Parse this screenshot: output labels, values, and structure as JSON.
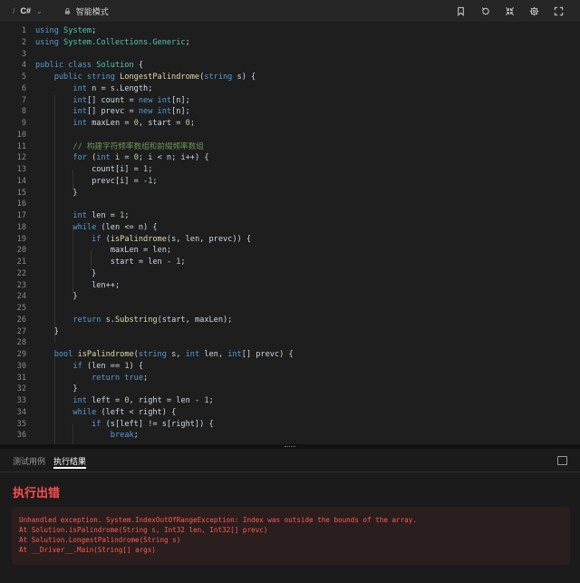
{
  "toolbar": {
    "slash": "/",
    "language": "C#",
    "chevron": "⌄",
    "mode_label": "智能模式",
    "icons": [
      "bookmark-icon",
      "undo-icon",
      "shrink-icon",
      "gear-icon",
      "fullscreen-icon"
    ]
  },
  "editor": {
    "lines": [
      {
        "n": "1",
        "t": [
          [
            "kw",
            "using "
          ],
          [
            "ty",
            "System"
          ],
          [
            "p",
            ";"
          ]
        ]
      },
      {
        "n": "2",
        "t": [
          [
            "kw",
            "using "
          ],
          [
            "ty",
            "System.Collections.Generic"
          ],
          [
            "p",
            ";"
          ]
        ]
      },
      {
        "n": "3",
        "t": []
      },
      {
        "n": "4",
        "t": [
          [
            "kw",
            "public class "
          ],
          [
            "ty",
            "Solution"
          ],
          [
            "p",
            " {"
          ]
        ]
      },
      {
        "n": "5",
        "t": [
          [
            "p",
            "    "
          ],
          [
            "kw",
            "public string "
          ],
          [
            "fn",
            "LongestPalindrome"
          ],
          [
            "p",
            "("
          ],
          [
            "kw",
            "string"
          ],
          [
            "p",
            " s) {"
          ]
        ]
      },
      {
        "n": "6",
        "t": [
          [
            "p",
            "        "
          ],
          [
            "kw",
            "int"
          ],
          [
            "p",
            " n = s.Length;"
          ]
        ]
      },
      {
        "n": "7",
        "t": [
          [
            "p",
            "        "
          ],
          [
            "kw",
            "int"
          ],
          [
            "p",
            "[] count = "
          ],
          [
            "kw",
            "new int"
          ],
          [
            "p",
            "[n];"
          ]
        ]
      },
      {
        "n": "8",
        "t": [
          [
            "p",
            "        "
          ],
          [
            "kw",
            "int"
          ],
          [
            "p",
            "[] prevc = "
          ],
          [
            "kw",
            "new int"
          ],
          [
            "p",
            "[n];"
          ]
        ]
      },
      {
        "n": "9",
        "t": [
          [
            "p",
            "        "
          ],
          [
            "kw",
            "int"
          ],
          [
            "p",
            " maxLen = "
          ],
          [
            "num",
            "0"
          ],
          [
            "p",
            ", start = "
          ],
          [
            "num",
            "0"
          ],
          [
            "p",
            ";"
          ]
        ]
      },
      {
        "n": "10",
        "t": []
      },
      {
        "n": "11",
        "t": [
          [
            "p",
            "        "
          ],
          [
            "cm",
            "// 构建字符频率数组和前缀频率数组"
          ]
        ]
      },
      {
        "n": "12",
        "t": [
          [
            "p",
            "        "
          ],
          [
            "kw",
            "for"
          ],
          [
            "p",
            " ("
          ],
          [
            "kw",
            "int"
          ],
          [
            "p",
            " i = "
          ],
          [
            "num",
            "0"
          ],
          [
            "p",
            "; i < n; i++) {"
          ]
        ]
      },
      {
        "n": "13",
        "t": [
          [
            "p",
            "            count[i] = "
          ],
          [
            "num",
            "1"
          ],
          [
            "p",
            ";"
          ]
        ]
      },
      {
        "n": "14",
        "t": [
          [
            "p",
            "            prevc[i] = -"
          ],
          [
            "num",
            "1"
          ],
          [
            "p",
            ";"
          ]
        ]
      },
      {
        "n": "15",
        "t": [
          [
            "p",
            "        }"
          ]
        ]
      },
      {
        "n": "16",
        "t": []
      },
      {
        "n": "17",
        "t": [
          [
            "p",
            "        "
          ],
          [
            "kw",
            "int"
          ],
          [
            "p",
            " len = "
          ],
          [
            "num",
            "1"
          ],
          [
            "p",
            ";"
          ]
        ]
      },
      {
        "n": "18",
        "t": [
          [
            "p",
            "        "
          ],
          [
            "kw",
            "while"
          ],
          [
            "p",
            " (len <= n) {"
          ]
        ]
      },
      {
        "n": "19",
        "t": [
          [
            "p",
            "            "
          ],
          [
            "kw",
            "if"
          ],
          [
            "p",
            " ("
          ],
          [
            "fn",
            "isPalindrome"
          ],
          [
            "p",
            "(s, len, prevc)) {"
          ]
        ]
      },
      {
        "n": "20",
        "t": [
          [
            "p",
            "                maxLen = len;"
          ]
        ]
      },
      {
        "n": "21",
        "t": [
          [
            "p",
            "                start = len - "
          ],
          [
            "num",
            "1"
          ],
          [
            "p",
            ";"
          ]
        ]
      },
      {
        "n": "22",
        "t": [
          [
            "p",
            "            }"
          ]
        ]
      },
      {
        "n": "23",
        "t": [
          [
            "p",
            "            len++;"
          ]
        ]
      },
      {
        "n": "24",
        "t": [
          [
            "p",
            "        }"
          ]
        ]
      },
      {
        "n": "25",
        "t": []
      },
      {
        "n": "26",
        "t": [
          [
            "p",
            "        "
          ],
          [
            "kw",
            "return"
          ],
          [
            "p",
            " s."
          ],
          [
            "fn",
            "Substring"
          ],
          [
            "p",
            "(start, maxLen);"
          ]
        ]
      },
      {
        "n": "27",
        "t": [
          [
            "p",
            "    }"
          ]
        ]
      },
      {
        "n": "28",
        "t": []
      },
      {
        "n": "29",
        "t": [
          [
            "p",
            "    "
          ],
          [
            "kw",
            "bool "
          ],
          [
            "fn",
            "isPalindrome"
          ],
          [
            "p",
            "("
          ],
          [
            "kw",
            "string"
          ],
          [
            "p",
            " s, "
          ],
          [
            "kw",
            "int"
          ],
          [
            "p",
            " len, "
          ],
          [
            "kw",
            "int"
          ],
          [
            "p",
            "[] prevc) {"
          ]
        ]
      },
      {
        "n": "30",
        "t": [
          [
            "p",
            "        "
          ],
          [
            "kw",
            "if"
          ],
          [
            "p",
            " (len == "
          ],
          [
            "num",
            "1"
          ],
          [
            "p",
            ") {"
          ]
        ]
      },
      {
        "n": "31",
        "t": [
          [
            "p",
            "            "
          ],
          [
            "kw",
            "return true"
          ],
          [
            "p",
            ";"
          ]
        ]
      },
      {
        "n": "32",
        "t": [
          [
            "p",
            "        }"
          ]
        ]
      },
      {
        "n": "33",
        "t": [
          [
            "p",
            "        "
          ],
          [
            "kw",
            "int"
          ],
          [
            "p",
            " left = "
          ],
          [
            "num",
            "0"
          ],
          [
            "p",
            ", right = len - "
          ],
          [
            "num",
            "1"
          ],
          [
            "p",
            ";"
          ]
        ]
      },
      {
        "n": "34",
        "t": [
          [
            "p",
            "        "
          ],
          [
            "kw",
            "while"
          ],
          [
            "p",
            " (left < right) {"
          ]
        ]
      },
      {
        "n": "35",
        "t": [
          [
            "p",
            "            "
          ],
          [
            "kw",
            "if"
          ],
          [
            "p",
            " (s[left] != s[right]) {"
          ]
        ]
      },
      {
        "n": "36",
        "t": [
          [
            "p",
            "                "
          ],
          [
            "kw",
            "break"
          ],
          [
            "p",
            ";"
          ]
        ]
      }
    ]
  },
  "panel": {
    "tabs": [
      "测试用例",
      "执行结果"
    ],
    "active_tab": 1,
    "error_title": "执行出错",
    "error_lines": [
      "Unhandled exception. System.IndexOutOfRangeException: Index was outside the bounds of the array.",
      "At Solution.isPalindrome(String s, Int32 len, Int32[] prevc)",
      "At Solution.LongestPalindrome(String s)",
      "At __Driver__.Main(String[] args)"
    ]
  }
}
